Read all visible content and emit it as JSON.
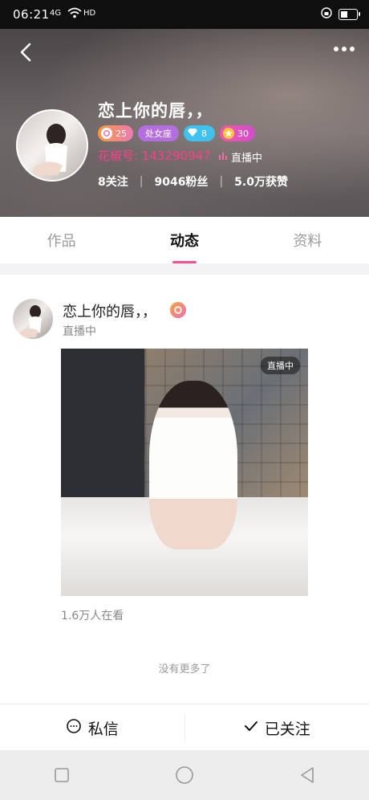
{
  "status_bar": {
    "time": "06:21",
    "network": "4G",
    "hd": "HD"
  },
  "profile": {
    "nickname": "恋上你的唇，，",
    "badges": {
      "level": "25",
      "zodiac": "处女座",
      "diamond": "8",
      "star": "30"
    },
    "id_text": "花椒号: 143290947",
    "live_status": "直播中",
    "stats": {
      "following": "8关注",
      "fans": "9046粉丝",
      "likes": "5.0万获赞"
    }
  },
  "tabs": [
    {
      "label": "作品"
    },
    {
      "label": "动态"
    },
    {
      "label": "资料"
    }
  ],
  "post": {
    "author": "恋上你的唇，，",
    "status": "直播中",
    "image_chip": "直播中",
    "viewers": "1.6万人在看"
  },
  "feed_footer": "没有更多了",
  "actions": {
    "message": "私信",
    "followed": "已关注"
  },
  "colors": {
    "accent": "#ff4c8e",
    "header_bg": "#5a5658"
  }
}
